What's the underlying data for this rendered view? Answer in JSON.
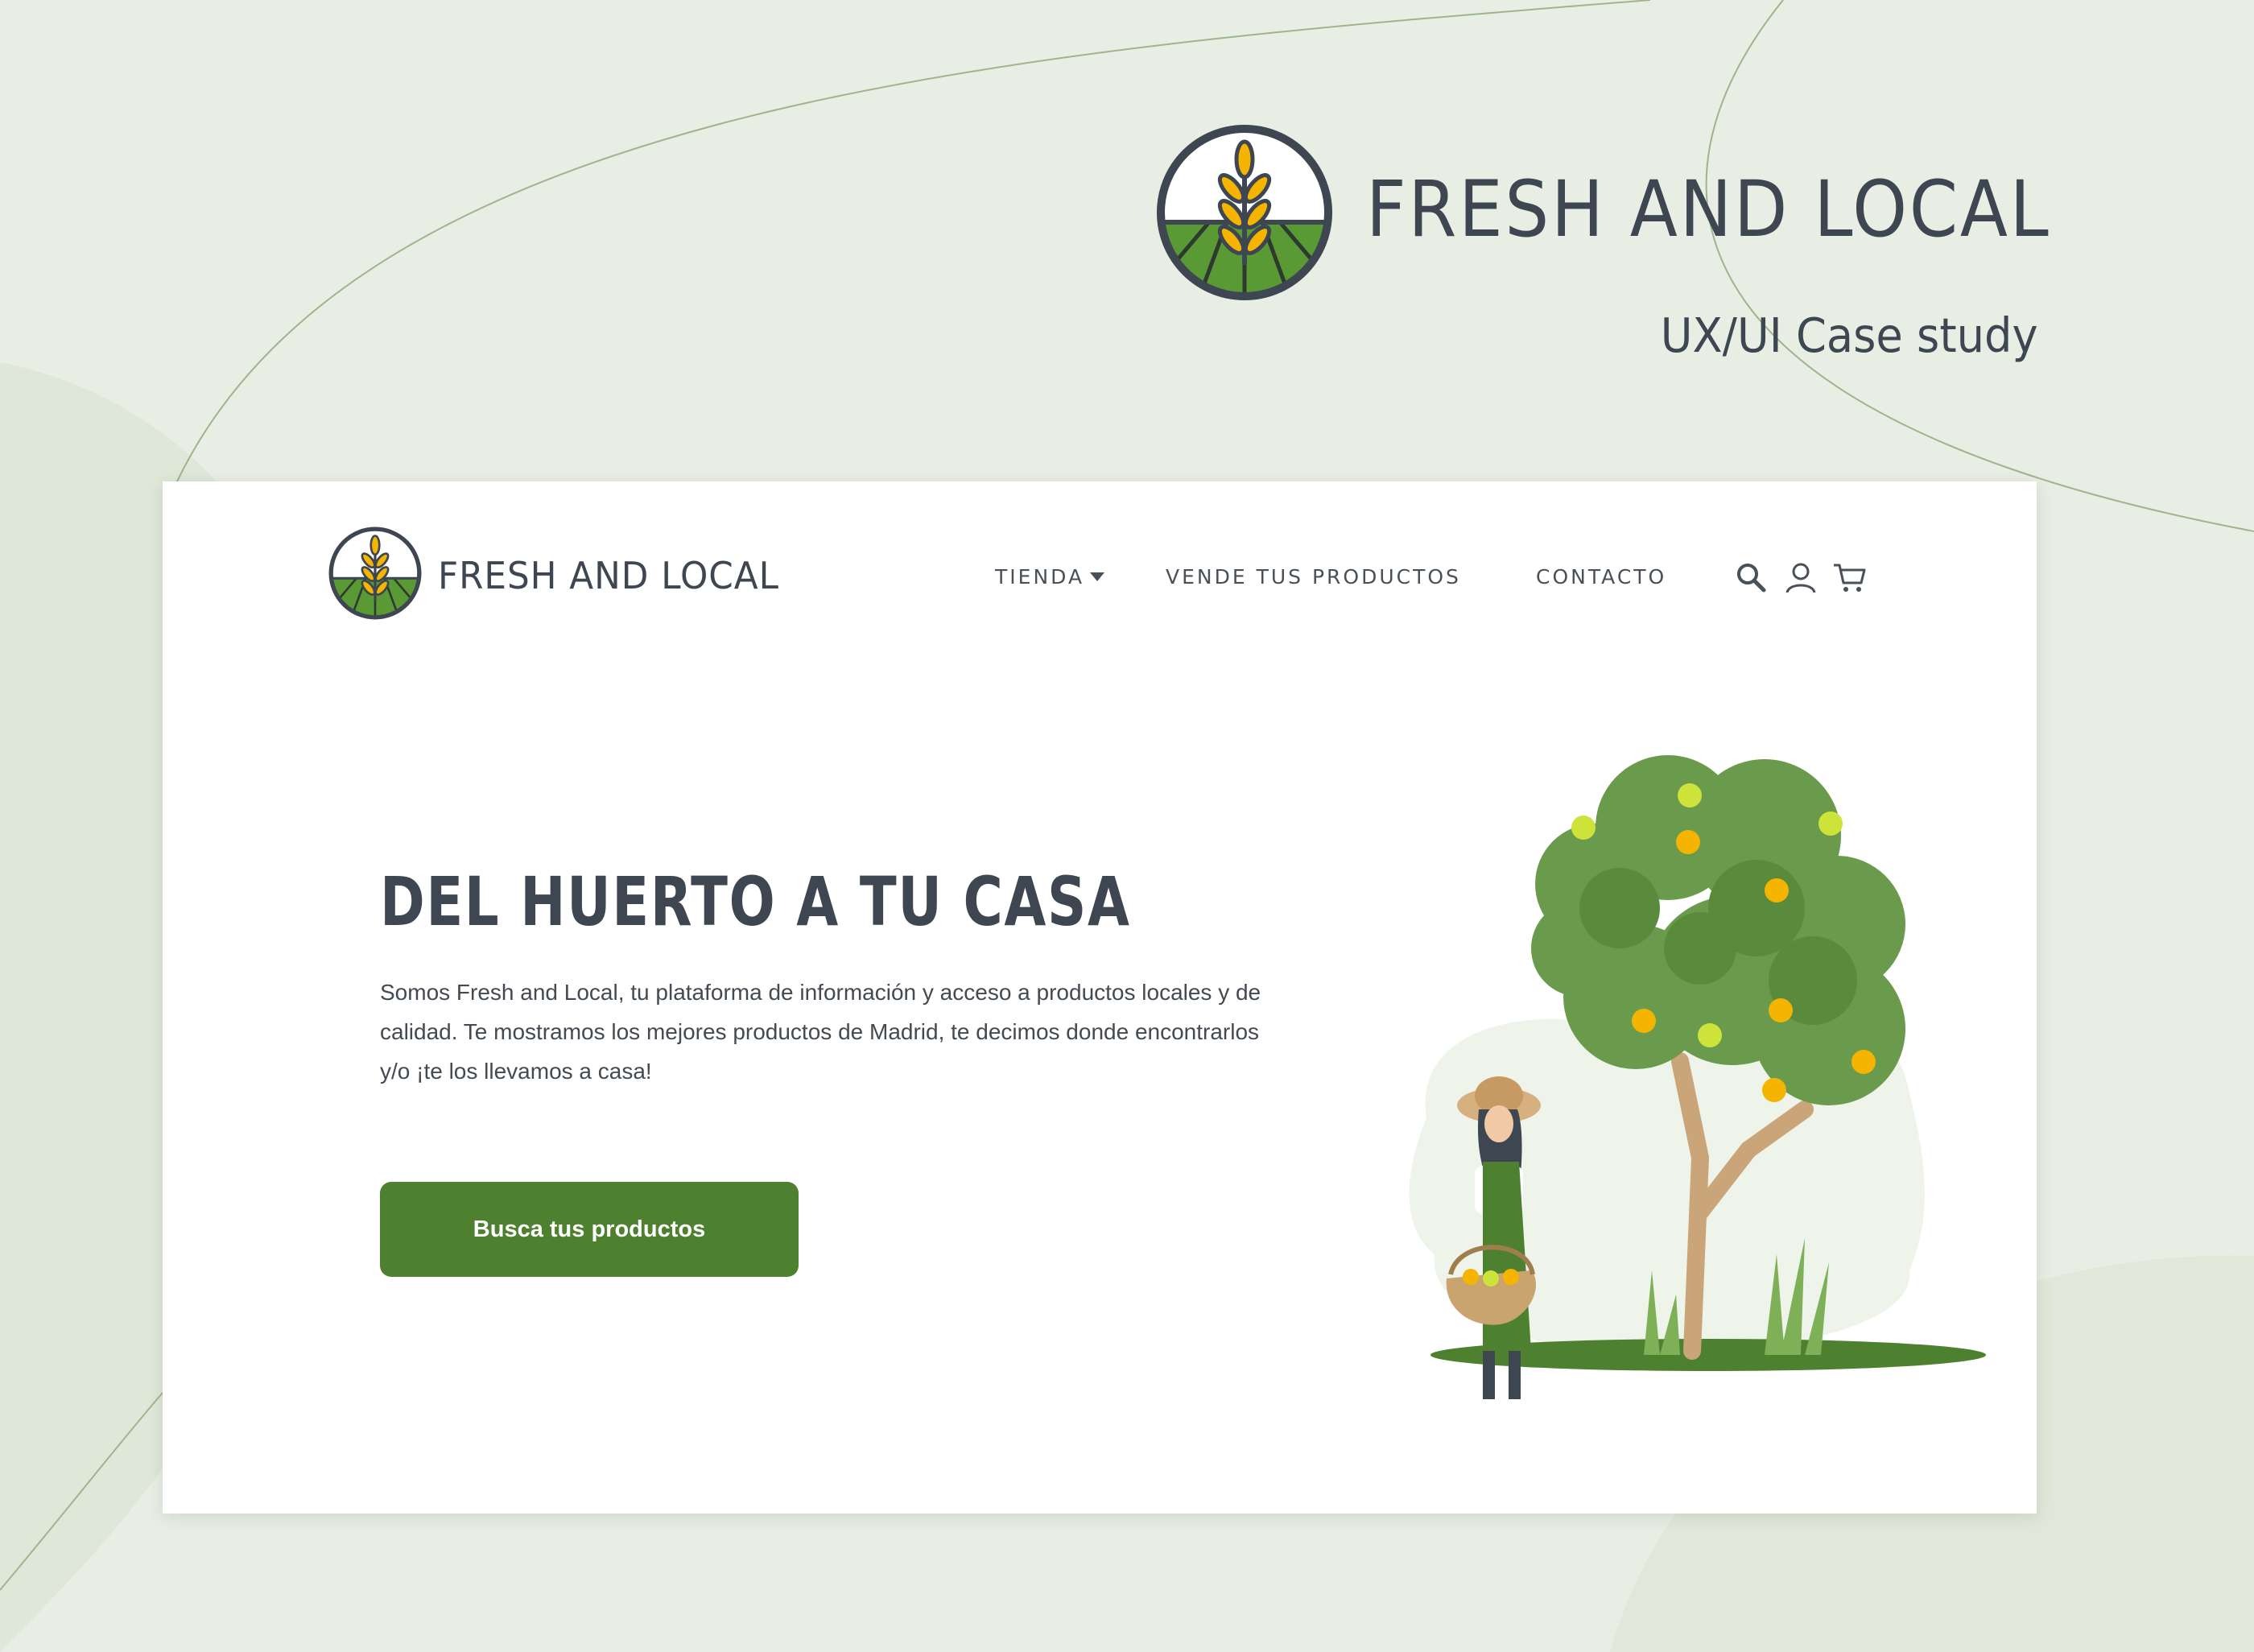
{
  "presentation": {
    "brand_title": "FRESH AND LOCAL",
    "subtitle": "UX/UI Case study"
  },
  "header": {
    "logo_title": "FRESH AND LOCAL",
    "nav": {
      "tienda": "TIENDA",
      "vende": "VENDE TUS PRODUCTOS",
      "contacto": "CONTACTO"
    },
    "icons": [
      "search-icon",
      "user-icon",
      "cart-icon"
    ]
  },
  "hero": {
    "headline": "DEL HUERTO A TU CASA",
    "intro": "Somos Fresh and Local, tu plataforma de información y acceso a productos locales y de calidad. Te mostramos los mejores productos de Madrid, te decimos donde encontrarlos y/o ¡te los llevamos a casa!",
    "cta": "Busca tus productos"
  },
  "colors": {
    "brand_green": "#4e812f",
    "logo_yellow": "#f5b400",
    "text_dark": "#3d4651",
    "background": "#e8eee3"
  }
}
